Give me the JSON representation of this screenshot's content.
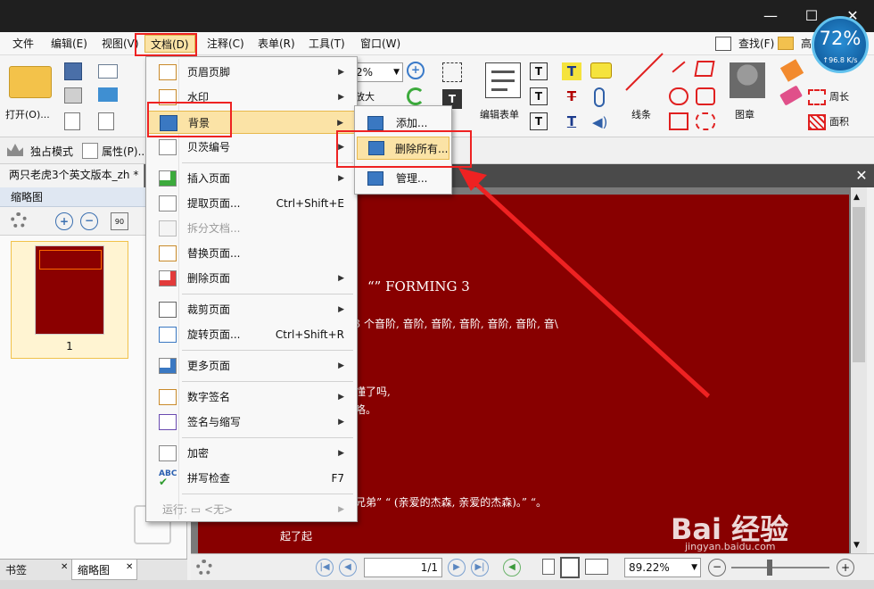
{
  "titlebar": {
    "minimize": "—",
    "maximize": "☐",
    "close": "✕",
    "net_percent": "72%",
    "net_speed": "↑96.8 K/s"
  },
  "menubar": {
    "items": [
      "文件",
      "编辑(E)",
      "视图(V)",
      "文档(D)",
      "注释(C)",
      "表单(R)",
      "工具(T)",
      "窗口(W)"
    ],
    "search_label": "查找(F)",
    "right_label": "高"
  },
  "ribbon": {
    "open_label": "打开(O)...",
    "zoom_value": "2%",
    "zoom_in_label": "放大",
    "edit_form_label": "编辑表单",
    "line_label": "线条",
    "stamp_label": "图章",
    "perimeter_label": "周长",
    "area_label": "面积"
  },
  "toolbar2": {
    "exclusive_mode": "独占模式",
    "properties": "属性(P)..."
  },
  "doc": {
    "tab_title": "两只老虎3个英文版本_zh *"
  },
  "thumbnails": {
    "header": "缩略图",
    "page_number": "1"
  },
  "bottom_tabs": {
    "bookmarks": "书签",
    "thumbnails": "缩略图"
  },
  "document_menu": {
    "items": [
      {
        "label": "页眉页脚",
        "shortcut": "",
        "submenu": true,
        "disabled": false
      },
      {
        "label": "水印",
        "shortcut": "",
        "submenu": true,
        "disabled": false
      },
      {
        "label": "背景",
        "shortcut": "",
        "submenu": true,
        "disabled": false
      },
      {
        "label": "贝茨编号",
        "shortcut": "",
        "submenu": true,
        "disabled": false
      },
      {
        "label": "插入页面",
        "shortcut": "",
        "submenu": true,
        "disabled": false
      },
      {
        "label": "提取页面...",
        "shortcut": "Ctrl+Shift+E",
        "submenu": false,
        "disabled": false
      },
      {
        "label": "拆分文档...",
        "shortcut": "",
        "submenu": false,
        "disabled": true
      },
      {
        "label": "替换页面...",
        "shortcut": "",
        "submenu": false,
        "disabled": false
      },
      {
        "label": "删除页面",
        "shortcut": "",
        "submenu": true,
        "disabled": false
      },
      {
        "label": "裁剪页面",
        "shortcut": "",
        "submenu": true,
        "disabled": false
      },
      {
        "label": "旋转页面...",
        "shortcut": "Ctrl+Shift+R",
        "submenu": false,
        "disabled": false
      },
      {
        "label": "更多页面",
        "shortcut": "",
        "submenu": true,
        "disabled": false
      },
      {
        "label": "数字签名",
        "shortcut": "",
        "submenu": true,
        "disabled": false
      },
      {
        "label": "签名与缩写",
        "shortcut": "",
        "submenu": true,
        "disabled": false
      },
      {
        "label": "加密",
        "shortcut": "",
        "submenu": true,
        "disabled": false
      },
      {
        "label": "拼写检查",
        "shortcut": "F7",
        "submenu": false,
        "disabled": false
      },
      {
        "label": "运行: ▭ <无>",
        "shortcut": "",
        "submenu": true,
        "disabled": true
      }
    ]
  },
  "background_submenu": {
    "add": "添加...",
    "delete_all": "删除所有...",
    "manage": "管理..."
  },
  "page_text": {
    "line1": "“” FORMING 3",
    "line2": "曲) 3 个音阶, 音阶, 音阶, 音阶, 音阶, 音阶, 音\\",
    "line3": "懂了吗,",
    "line4": "咯。",
    "line5": "兄弟” “ (亲爱的杰森, 亲爱的杰森)。” “。",
    "line6": "起了起"
  },
  "statusbar": {
    "page_input": "1/1",
    "zoom_value": "89.22%"
  },
  "watermark": {
    "text": "Bai 经验",
    "sub": "jingyan.baidu.com"
  },
  "colors": {
    "highlight_red": "#ee2222",
    "page_bg": "#880000",
    "menu_hover": "#fbe3a6"
  }
}
